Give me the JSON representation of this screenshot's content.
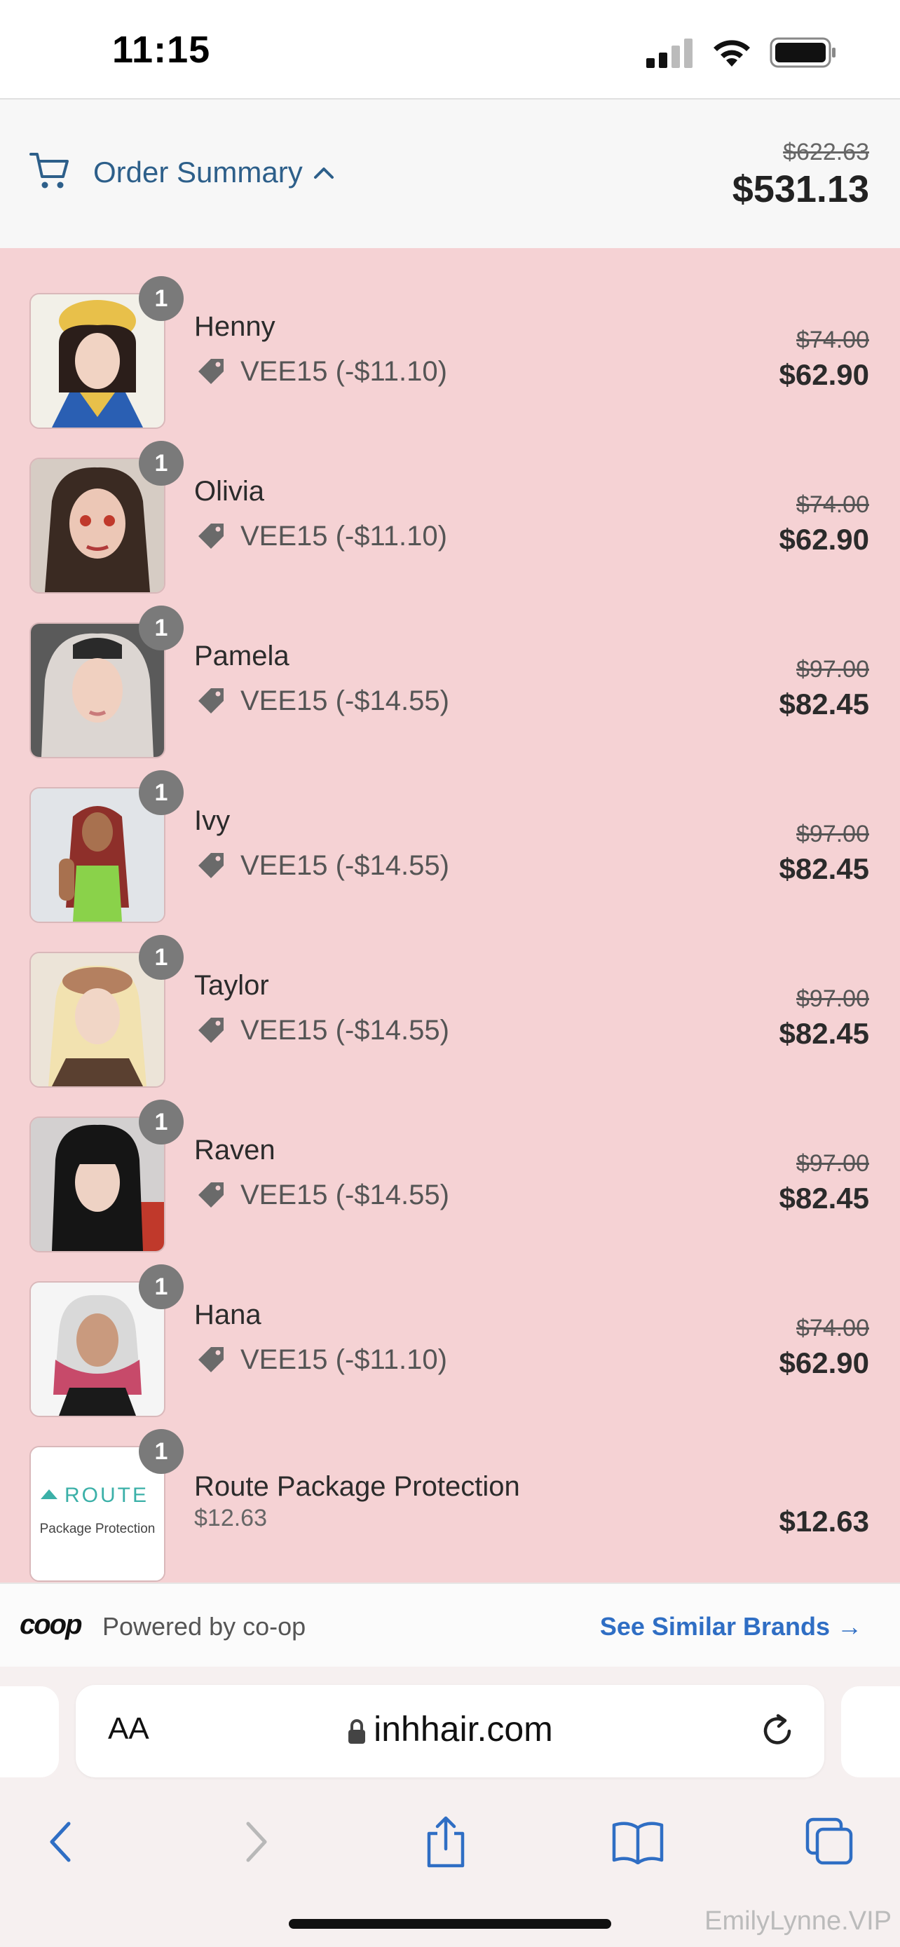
{
  "status": {
    "time": "11:15"
  },
  "summary": {
    "label": "Order Summary",
    "old_total": "$622.63",
    "total": "$531.13"
  },
  "items": [
    {
      "name": "Henny",
      "qty": "1",
      "discount": "VEE15 (-$11.10)",
      "old_price": "$74.00",
      "price": "$62.90",
      "thumb_bg": "#e8c86a"
    },
    {
      "name": "Olivia",
      "qty": "1",
      "discount": "VEE15 (-$11.10)",
      "old_price": "$74.00",
      "price": "$62.90",
      "thumb_bg": "#cfc6c0"
    },
    {
      "name": "Pamela",
      "qty": "1",
      "discount": "VEE15 (-$14.55)",
      "old_price": "$97.00",
      "price": "$82.45",
      "thumb_bg": "#c9c3c0"
    },
    {
      "name": "Ivy",
      "qty": "1",
      "discount": "VEE15 (-$14.55)",
      "old_price": "$97.00",
      "price": "$82.45",
      "thumb_bg": "#dde1e6"
    },
    {
      "name": "Taylor",
      "qty": "1",
      "discount": "VEE15 (-$14.55)",
      "old_price": "$97.00",
      "price": "$82.45",
      "thumb_bg": "#e9e1d5"
    },
    {
      "name": "Raven",
      "qty": "1",
      "discount": "VEE15 (-$14.55)",
      "old_price": "$97.00",
      "price": "$82.45",
      "thumb_bg": "#d8d4d4"
    },
    {
      "name": "Hana",
      "qty": "1",
      "discount": "VEE15 (-$11.10)",
      "old_price": "$74.00",
      "price": "$62.90",
      "thumb_bg": "#f3f3f3"
    }
  ],
  "route": {
    "name": "Route Package Protection",
    "qty": "1",
    "sub_price": "$12.63",
    "price": "$12.63",
    "logo_text": "ROUTE",
    "logo_sub": "Package Protection"
  },
  "coop": {
    "logo": "coop",
    "powered": "Powered by co-op",
    "link": "See Similar Brands →"
  },
  "browser": {
    "aa_label": "AA",
    "url": "inhhair.com"
  },
  "watermark": "EmilyLynne.VIP",
  "colors": {
    "accent_blue": "#2d5f8a",
    "link_blue": "#2f6ec4",
    "list_bg": "#f5d2d4"
  }
}
